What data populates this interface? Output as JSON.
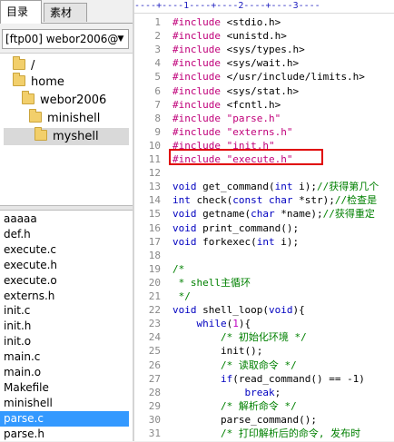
{
  "left_panel": {
    "tabs": [
      {
        "label": "目录",
        "active": true
      },
      {
        "label": "素材",
        "active": false
      }
    ],
    "server_select": {
      "value": "[ftp00] webor2006@"
    },
    "tree": [
      {
        "label": "/",
        "selected": false
      },
      {
        "label": "home",
        "selected": false
      },
      {
        "label": "webor2006",
        "selected": false
      },
      {
        "label": "minishell",
        "selected": false
      },
      {
        "label": "myshell",
        "selected": true
      }
    ],
    "files": [
      {
        "name": "aaaaa",
        "selected": false
      },
      {
        "name": "def.h",
        "selected": false
      },
      {
        "name": "execute.c",
        "selected": false
      },
      {
        "name": "execute.h",
        "selected": false
      },
      {
        "name": "execute.o",
        "selected": false
      },
      {
        "name": "externs.h",
        "selected": false
      },
      {
        "name": "init.c",
        "selected": false
      },
      {
        "name": "init.h",
        "selected": false
      },
      {
        "name": "init.o",
        "selected": false
      },
      {
        "name": "main.c",
        "selected": false
      },
      {
        "name": "main.o",
        "selected": false
      },
      {
        "name": "Makefile",
        "selected": false
      },
      {
        "name": "minishell",
        "selected": false
      },
      {
        "name": "parse.c",
        "selected": true
      },
      {
        "name": "parse.h",
        "selected": false
      }
    ]
  },
  "editor": {
    "ruler": "----+----1----+----2----+----3----",
    "lines": [
      {
        "n": "1",
        "tokens": [
          {
            "t": "#include ",
            "c": "pp"
          },
          {
            "t": "<stdio.h>",
            "c": ""
          }
        ]
      },
      {
        "n": "2",
        "tokens": [
          {
            "t": "#include ",
            "c": "pp"
          },
          {
            "t": "<unistd.h>",
            "c": ""
          }
        ]
      },
      {
        "n": "3",
        "tokens": [
          {
            "t": "#include ",
            "c": "pp"
          },
          {
            "t": "<sys/types.h>",
            "c": ""
          }
        ]
      },
      {
        "n": "4",
        "tokens": [
          {
            "t": "#include ",
            "c": "pp"
          },
          {
            "t": "<sys/wait.h>",
            "c": ""
          }
        ]
      },
      {
        "n": "5",
        "tokens": [
          {
            "t": "#include ",
            "c": "pp"
          },
          {
            "t": "</usr/include/limits.h>",
            "c": ""
          }
        ]
      },
      {
        "n": "6",
        "tokens": [
          {
            "t": "#include ",
            "c": "pp"
          },
          {
            "t": "<sys/stat.h>",
            "c": ""
          }
        ]
      },
      {
        "n": "7",
        "tokens": [
          {
            "t": "#include ",
            "c": "pp"
          },
          {
            "t": "<fcntl.h>",
            "c": ""
          }
        ]
      },
      {
        "n": "8",
        "tokens": [
          {
            "t": "#include ",
            "c": "pp"
          },
          {
            "t": "\"parse.h\"",
            "c": "str"
          }
        ]
      },
      {
        "n": "9",
        "tokens": [
          {
            "t": "#include ",
            "c": "pp"
          },
          {
            "t": "\"externs.h\"",
            "c": "str"
          }
        ]
      },
      {
        "n": "10",
        "tokens": [
          {
            "t": "#include ",
            "c": "pp"
          },
          {
            "t": "\"init.h\"",
            "c": "str"
          }
        ]
      },
      {
        "n": "11",
        "tokens": [
          {
            "t": "#include ",
            "c": "pp"
          },
          {
            "t": "\"execute.h\"",
            "c": "str"
          }
        ]
      },
      {
        "n": "12",
        "tokens": []
      },
      {
        "n": "13",
        "tokens": [
          {
            "t": "void",
            "c": "kw"
          },
          {
            "t": " get_command(",
            "c": ""
          },
          {
            "t": "int",
            "c": "kw"
          },
          {
            "t": " i);",
            "c": ""
          },
          {
            "t": "//获得第几个",
            "c": "cm"
          }
        ]
      },
      {
        "n": "14",
        "tokens": [
          {
            "t": "int",
            "c": "kw"
          },
          {
            "t": " check(",
            "c": ""
          },
          {
            "t": "const char",
            "c": "kw"
          },
          {
            "t": " *str);",
            "c": ""
          },
          {
            "t": "//检查是",
            "c": "cm"
          }
        ]
      },
      {
        "n": "15",
        "tokens": [
          {
            "t": "void",
            "c": "kw"
          },
          {
            "t": " getname(",
            "c": ""
          },
          {
            "t": "char",
            "c": "kw"
          },
          {
            "t": " *name);",
            "c": ""
          },
          {
            "t": "//获得重定",
            "c": "cm"
          }
        ]
      },
      {
        "n": "16",
        "tokens": [
          {
            "t": "void",
            "c": "kw"
          },
          {
            "t": " print_command();",
            "c": ""
          }
        ]
      },
      {
        "n": "17",
        "tokens": [
          {
            "t": "void",
            "c": "kw"
          },
          {
            "t": " forkexec(",
            "c": ""
          },
          {
            "t": "int",
            "c": "kw"
          },
          {
            "t": " i);",
            "c": ""
          }
        ]
      },
      {
        "n": "18",
        "tokens": []
      },
      {
        "n": "19",
        "tokens": [
          {
            "t": "/*",
            "c": "cm"
          }
        ]
      },
      {
        "n": "20",
        "tokens": [
          {
            "t": " * shell主循环",
            "c": "cm"
          }
        ]
      },
      {
        "n": "21",
        "tokens": [
          {
            "t": " */",
            "c": "cm"
          }
        ]
      },
      {
        "n": "22",
        "tokens": [
          {
            "t": "void",
            "c": "kw"
          },
          {
            "t": " shell_loop(",
            "c": ""
          },
          {
            "t": "void",
            "c": "kw"
          },
          {
            "t": ")",
            "c": ""
          },
          {
            "t": "{",
            "c": ""
          }
        ]
      },
      {
        "n": "23",
        "tokens": [
          {
            "t": "    ",
            "c": ""
          },
          {
            "t": "while",
            "c": "kw"
          },
          {
            "t": "(",
            "c": ""
          },
          {
            "t": "1",
            "c": "num"
          },
          {
            "t": "){",
            "c": ""
          }
        ]
      },
      {
        "n": "24",
        "tokens": [
          {
            "t": "        ",
            "c": ""
          },
          {
            "t": "/* 初始化环境 */",
            "c": "cm"
          }
        ]
      },
      {
        "n": "25",
        "tokens": [
          {
            "t": "        init();",
            "c": ""
          }
        ]
      },
      {
        "n": "26",
        "tokens": [
          {
            "t": "        ",
            "c": ""
          },
          {
            "t": "/* 读取命令 */",
            "c": "cm"
          }
        ]
      },
      {
        "n": "27",
        "tokens": [
          {
            "t": "        ",
            "c": ""
          },
          {
            "t": "if",
            "c": "kw"
          },
          {
            "t": "(read_command() == -1)",
            "c": ""
          }
        ]
      },
      {
        "n": "28",
        "tokens": [
          {
            "t": "            ",
            "c": ""
          },
          {
            "t": "break",
            "c": "kw"
          },
          {
            "t": ";",
            "c": ""
          }
        ]
      },
      {
        "n": "29",
        "tokens": [
          {
            "t": "        ",
            "c": ""
          },
          {
            "t": "/* 解析命令 */",
            "c": "cm"
          }
        ]
      },
      {
        "n": "30",
        "tokens": [
          {
            "t": "        parse_command();",
            "c": ""
          }
        ]
      },
      {
        "n": "31",
        "tokens": [
          {
            "t": "        ",
            "c": ""
          },
          {
            "t": "/* 打印解析后的命令, 发布时",
            "c": "cm"
          }
        ]
      }
    ]
  },
  "colors": {
    "selection": "#3399ff",
    "highlight_box": "#e00000",
    "preprocessor": "#c0007a",
    "keyword": "#0000c0",
    "comment": "#008000"
  }
}
